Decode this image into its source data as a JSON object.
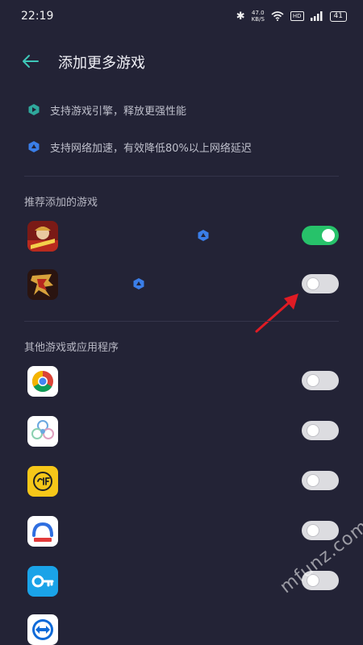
{
  "status_bar": {
    "time": "22:19",
    "speed_value": "47.0",
    "speed_unit": "KB/S",
    "network_badge": "HD",
    "battery": "41"
  },
  "header": {
    "title": "添加更多游戏"
  },
  "features": [
    {
      "text": "支持游戏引擎，释放更强性能",
      "icon": "engine-icon"
    },
    {
      "text": "支持网络加速，有效降低80%以上网络延迟",
      "icon": "network-accelerate-icon"
    }
  ],
  "sections": {
    "recommended_title": "推荐添加的游戏",
    "other_title": "其他游戏或应用程序"
  },
  "recommended_games": [
    {
      "icon": "game-icon-one-piece",
      "accelerated": true,
      "enabled": true
    },
    {
      "icon": "game-icon-calligraphy",
      "accelerated": true,
      "enabled": false
    }
  ],
  "other_apps": [
    {
      "icon": "chrome-icon",
      "enabled": false
    },
    {
      "icon": "flower-app-icon",
      "enabled": false
    },
    {
      "icon": "gif-app-icon",
      "enabled": false
    },
    {
      "icon": "cloud-app-icon",
      "enabled": false
    },
    {
      "icon": "key-app-icon",
      "enabled": false
    },
    {
      "icon": "teamviewer-icon",
      "enabled": false
    }
  ],
  "watermark": "mfunz.com",
  "colors": {
    "background": "#232336",
    "toggle_on": "#27c26a",
    "accent": "#4fa6ff",
    "arrow": "#e01b24"
  }
}
